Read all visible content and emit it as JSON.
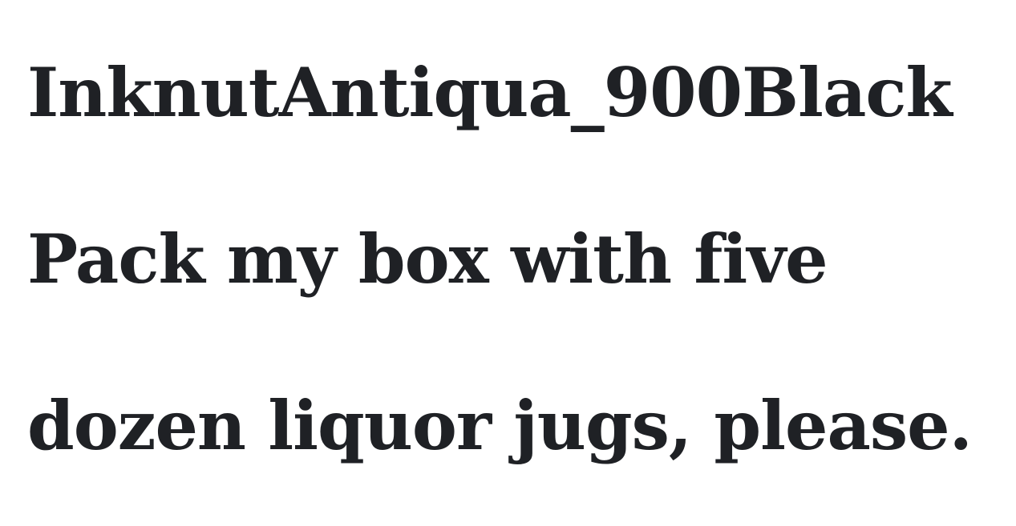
{
  "font_name": "InknutAntiqua_900Black",
  "sample_text": {
    "line1": "Pack my box with five",
    "line2": "dozen liquor jugs, please."
  },
  "text_color": "#1f2125",
  "background_color": "#ffffff"
}
